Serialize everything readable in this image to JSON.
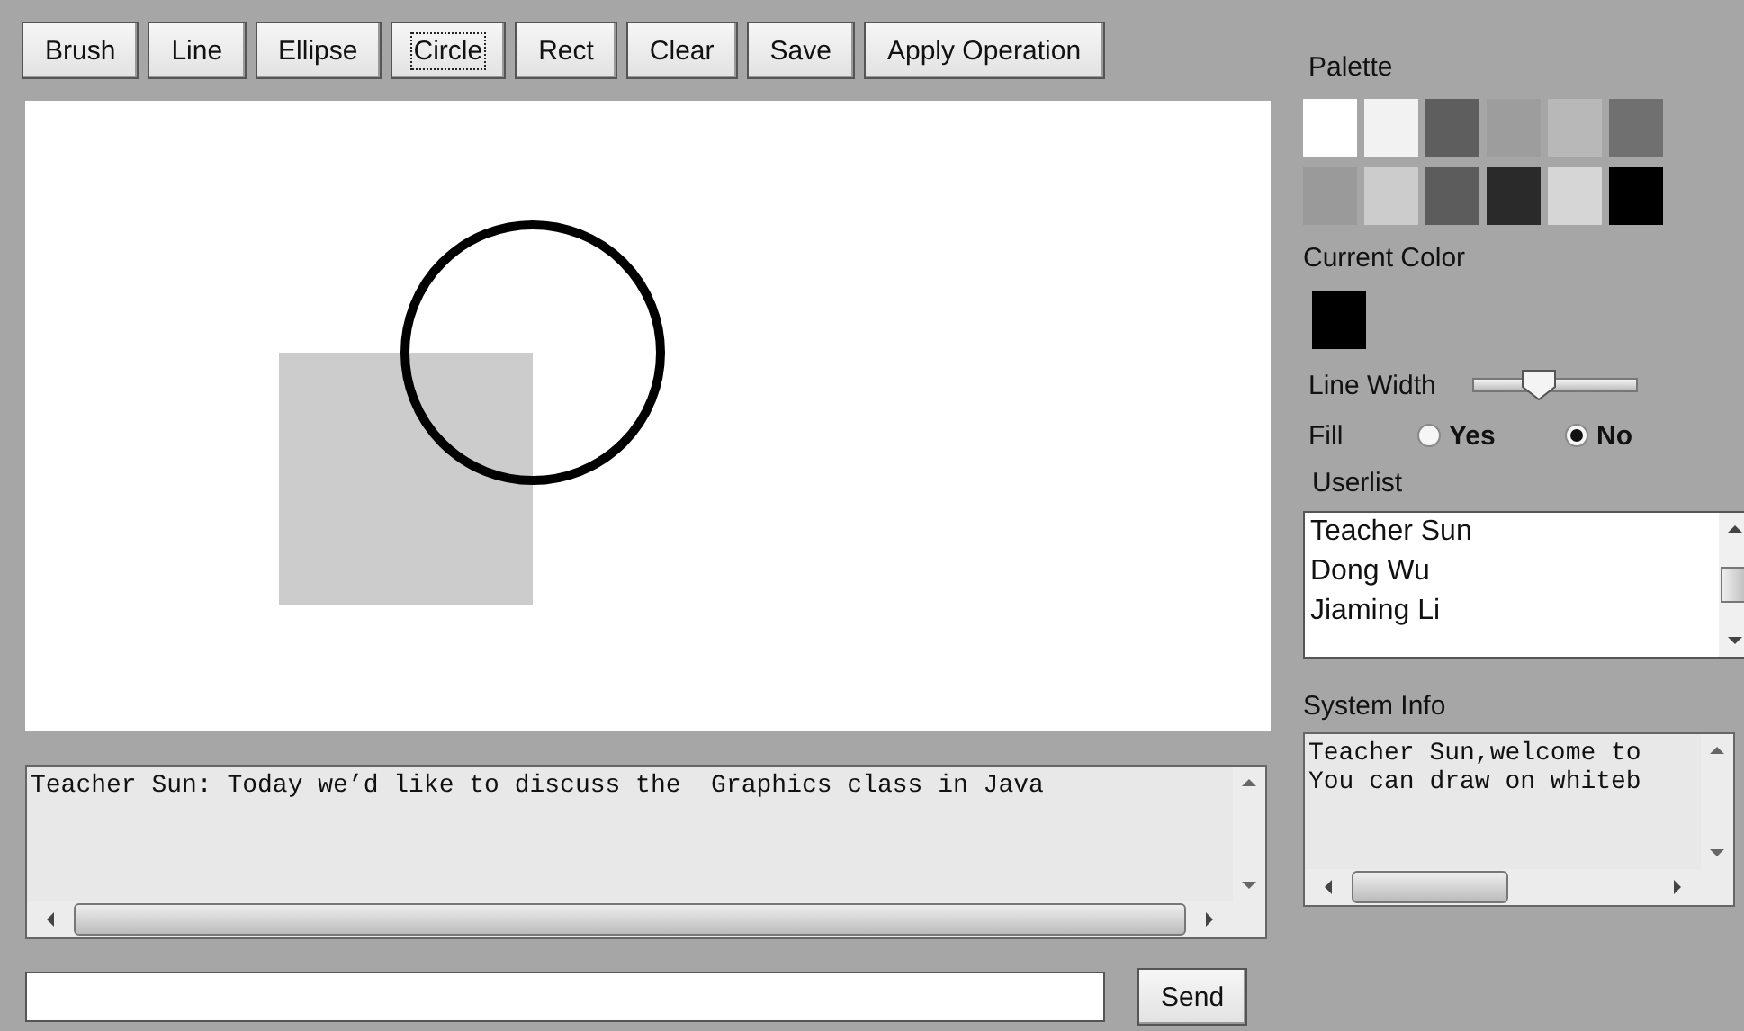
{
  "toolbar": [
    {
      "label": "Brush",
      "selected": false
    },
    {
      "label": "Line",
      "selected": false
    },
    {
      "label": "Ellipse",
      "selected": false
    },
    {
      "label": "Circle",
      "selected": true
    },
    {
      "label": "Rect",
      "selected": false
    },
    {
      "label": "Clear",
      "selected": false
    },
    {
      "label": "Save",
      "selected": false
    },
    {
      "label": "Apply Operation",
      "selected": false
    }
  ],
  "chat": {
    "text": "Teacher Sun: Today we’d like to discuss the  Graphics class in Java"
  },
  "message_input": {
    "send_label": "Send"
  },
  "palette": {
    "label": "Palette",
    "swatches": [
      {
        "color": "#ffffff"
      },
      {
        "color": "#f2f2f2"
      },
      {
        "color": "#5e5e5e"
      },
      {
        "color": "#9d9d9d"
      },
      {
        "color": "#b8b8b8"
      },
      {
        "color": "#707070"
      },
      {
        "color": "#9a9a9a"
      },
      {
        "color": "#cccccc"
      },
      {
        "color": "#5c5c5c"
      },
      {
        "color": "#2a2a2a"
      },
      {
        "color": "#d6d6d6"
      },
      {
        "color": "#000000"
      }
    ]
  },
  "current_color": {
    "label": "Current Color",
    "color": "#000000"
  },
  "line_width": {
    "label": "Line Width",
    "level": 0.33
  },
  "fill": {
    "label": "Fill",
    "options": [
      {
        "label": "Yes",
        "selected": false
      },
      {
        "label": "No",
        "selected": true
      }
    ]
  },
  "userlist": {
    "label": "Userlist",
    "users": [
      "Teacher Sun",
      "Dong Wu",
      "Jiaming Li"
    ]
  },
  "system_info": {
    "label": "System Info",
    "lines": [
      "Teacher Sun,welcome to",
      "You can draw on whiteb"
    ]
  }
}
